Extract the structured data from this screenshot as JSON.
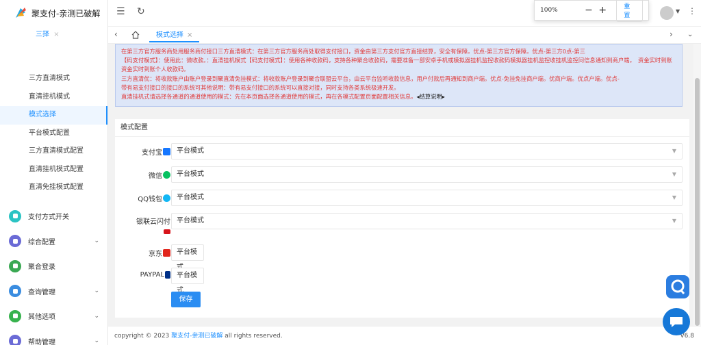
{
  "app": {
    "title": "聚支付-亲测已破解"
  },
  "sidebar": {
    "top_sub": "三择",
    "sub_items": [
      {
        "label": "三方直清模式"
      },
      {
        "label": "直清挂机模式"
      },
      {
        "label": "模式选择",
        "active": true
      },
      {
        "label": "平台模式配置"
      },
      {
        "label": "三方直清模式配置"
      },
      {
        "label": "直清挂机模式配置"
      },
      {
        "label": "直清免挂模式配置"
      }
    ],
    "items": [
      {
        "label": "支付方式开关",
        "icon": "toggle-icon",
        "color": "#2bc3c3",
        "chevron": false
      },
      {
        "label": "综合配置",
        "icon": "cog-icon",
        "color": "#6b6bd6",
        "chevron": true
      },
      {
        "label": "聚合登录",
        "icon": "login-icon",
        "color": "#3aa853",
        "chevron": false
      },
      {
        "label": "查询管理",
        "icon": "query-icon",
        "color": "#3b8de0",
        "chevron": true
      },
      {
        "label": "其他选项",
        "icon": "options-icon",
        "color": "#37b24d",
        "chevron": true
      },
      {
        "label": "帮助管理",
        "icon": "help-icon",
        "color": "#6b6bd6",
        "chevron": true
      }
    ]
  },
  "topbar": {
    "menu_icon": "menu-fold-icon",
    "refresh_icon": "refresh-icon"
  },
  "zoom": {
    "value": "100%",
    "minus": "−",
    "plus": "+",
    "reset_label": "重置"
  },
  "tabs": [
    {
      "label": "模式选择",
      "close": "×"
    }
  ],
  "notice": {
    "lines": [
      "在第三方官方服务商处用服务商付接口三方直清模式：在第三方官方服务商处取得支付接口，资金由第三方支付官方直接结算，安全有保障。优点-第三方官方保障。优点-第三方0点-第三",
      "【码支付模式】：使用此：微收款。：直清挂机模式【码支付模式】：使用各种收款码，支持各种聚合收款码，需要准备一部安卓手机或模拟器挂机监控收款码模拟器挂机监控收挂机监控问信息通知到商户端。　资金实时到账资金实时到账个人收款码。",
      "三方直清优：将收款账户由账户登录到聚直清免挂模式：将收款账户登录到聚合联盟云平台，由云平台监听收款信息，用户付款后再通知到商户端。优点-免挂免挂商户端。优商户端。优点户端。优点-",
      "带有易支付接口的接口的系统可其他说明：带有易支付接口的系统可以直接对接，同时支持各类系统极速开发。",
      "直清挂机式请选择各通道的通道使用的模式：先在本页面选择各通道使用的模式，再在各模式配置页面配置相关信息。"
    ],
    "tail": "◂结算说明▸"
  },
  "form": {
    "title": "模式配置",
    "rows": [
      {
        "label": "支付宝",
        "value": "平台模式",
        "badge_color": "#1677ff",
        "badge_icon": "alipay-icon"
      },
      {
        "label": "微信",
        "value": "平台模式",
        "badge_color": "#07c160",
        "badge_icon": "wechat-icon"
      },
      {
        "label": "QQ钱包",
        "value": "平台模式",
        "badge_color": "#12b7f5",
        "badge_icon": "qq-icon"
      },
      {
        "label": "银联云闪付",
        "value": "平台模式",
        "badge_color": "#d7141a",
        "badge_icon": "unionpay-icon"
      },
      {
        "label": "京东",
        "value": "平台模式",
        "badge_color": "#e1251b",
        "badge_icon": "jd-icon"
      },
      {
        "label": "PAYPAL",
        "value": "平台模式",
        "badge_color": "#003087",
        "badge_icon": "paypal-icon"
      }
    ],
    "save_label": "保存"
  },
  "footer": {
    "prefix": "copyright © 2023 ",
    "brand": "聚支付-亲测已破解",
    "suffix": " all rights reserved.",
    "version": "V6.8"
  }
}
